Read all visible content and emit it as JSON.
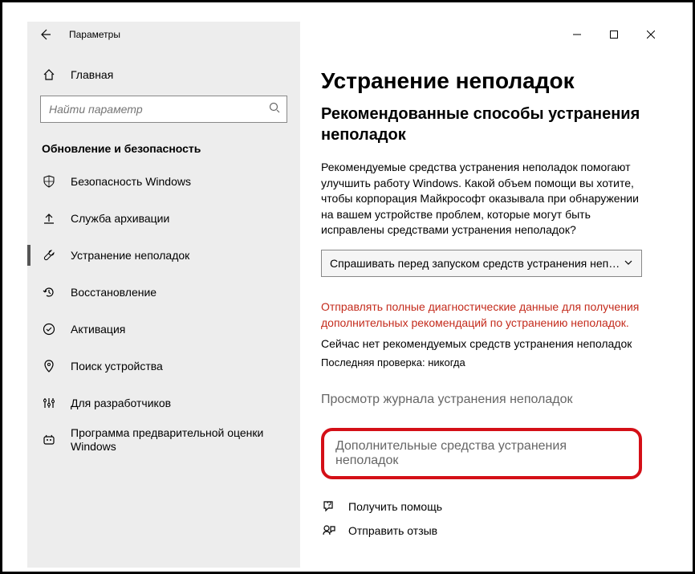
{
  "titlebar": {
    "title": "Параметры"
  },
  "sidebar": {
    "home": "Главная",
    "search_placeholder": "Найти параметр",
    "section": "Обновление и безопасность",
    "items": [
      {
        "label": "Безопасность Windows"
      },
      {
        "label": "Служба архивации"
      },
      {
        "label": "Устранение неполадок"
      },
      {
        "label": "Восстановление"
      },
      {
        "label": "Активация"
      },
      {
        "label": "Поиск устройства"
      },
      {
        "label": "Для разработчиков"
      },
      {
        "label": "Программа предварительной оценки Windows"
      }
    ]
  },
  "main": {
    "h1": "Устранение неполадок",
    "h2": "Рекомендованные способы устранения неполадок",
    "desc": "Рекомендуемые средства устранения неполадок помогают улучшить работу Windows. Какой объем помощи вы хотите, чтобы корпорация Майкрософт оказывала при обнаружении на вашем устройстве проблем, которые могут быть исправлены средствами устранения неполадок?",
    "dropdown_label": "Спрашивать перед запуском средств устранения неполадок",
    "red_note": "Отправлять полные диагностические данные для получения дополнительных рекомендаций по устранению неполадок.",
    "no_rec": "Сейчас нет рекомендуемых средств устранения неполадок",
    "last_check": "Последняя проверка: никогда",
    "history_link": "Просмотр журнала устранения неполадок",
    "extra_link": "Дополнительные средства устранения неполадок",
    "help_link": "Получить помощь",
    "feedback_link": "Отправить отзыв"
  }
}
